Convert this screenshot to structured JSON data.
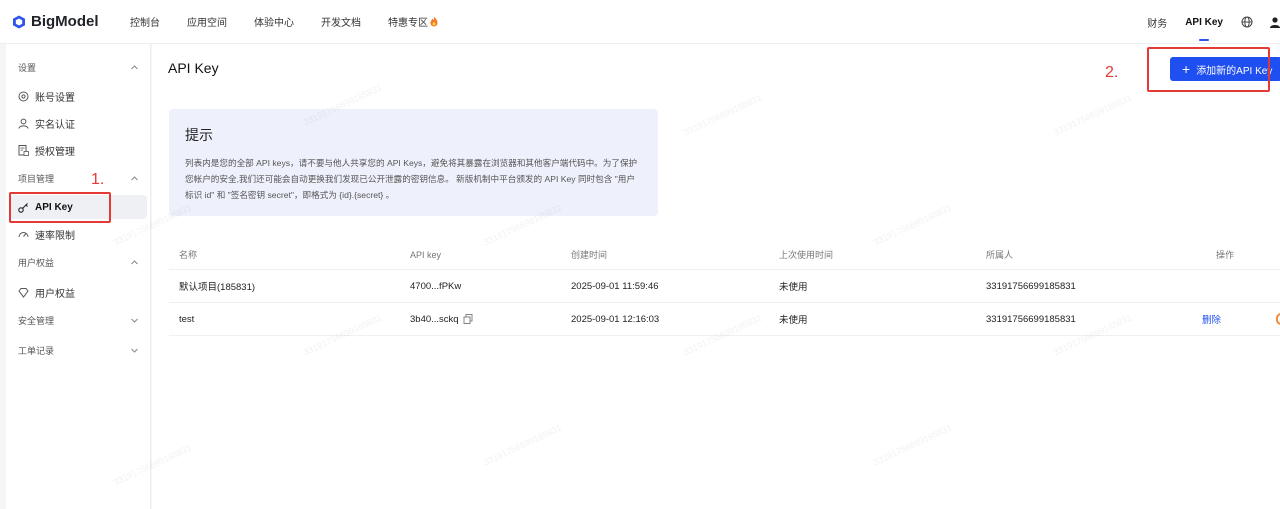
{
  "brand": {
    "name": "BigModel"
  },
  "nav": [
    "控制台",
    "应用空间",
    "体验中心",
    "开发文档",
    "特惠专区"
  ],
  "right_nav": {
    "finance": "财务",
    "api_key": "API Key"
  },
  "sidebar": {
    "groups": {
      "settings": "设置",
      "project": "项目管理",
      "benefits": "用户权益",
      "security": "安全管理",
      "tickets": "工单记录"
    },
    "items": {
      "account": "账号设置",
      "realname": "实名认证",
      "auth": "授权管理",
      "apikey": "API Key",
      "ratelimit": "速率限制",
      "userbenefits": "用户权益"
    }
  },
  "annotations": {
    "one": "1.",
    "two": "2."
  },
  "page": {
    "title": "API Key",
    "add_button": "添加新的API Key"
  },
  "tip": {
    "title": "提示",
    "body": "列表内是您的全部 API keys，请不要与他人共享您的 API Keys，避免将其暴露在浏览器和其他客户端代码中。为了保护您帐户的安全,我们还可能会自动更换我们发现已公开泄露的密钥信息。 新版机制中平台颁发的 API Key 同时包含 \"用户标识 id\" 和 \"签名密钥 secret\"，即格式为 {id}.{secret} 。"
  },
  "table": {
    "headers": [
      "名称",
      "API key",
      "创建时间",
      "上次使用时间",
      "所属人",
      "操作"
    ],
    "rows": [
      {
        "name": "默认项目(185831)",
        "key": "4700...fPKw",
        "created": "2025-09-01 11:59:46",
        "last_used": "未使用",
        "owner": "33191756699185831",
        "action": ""
      },
      {
        "name": "test",
        "key": "3b40...sckq",
        "created": "2025-09-01 12:16:03",
        "last_used": "未使用",
        "owner": "33191756699185831",
        "action": "删除"
      }
    ]
  },
  "watermark": "33191756699185831",
  "colors": {
    "accent": "#1f4ff0",
    "annotation": "#e53935"
  }
}
